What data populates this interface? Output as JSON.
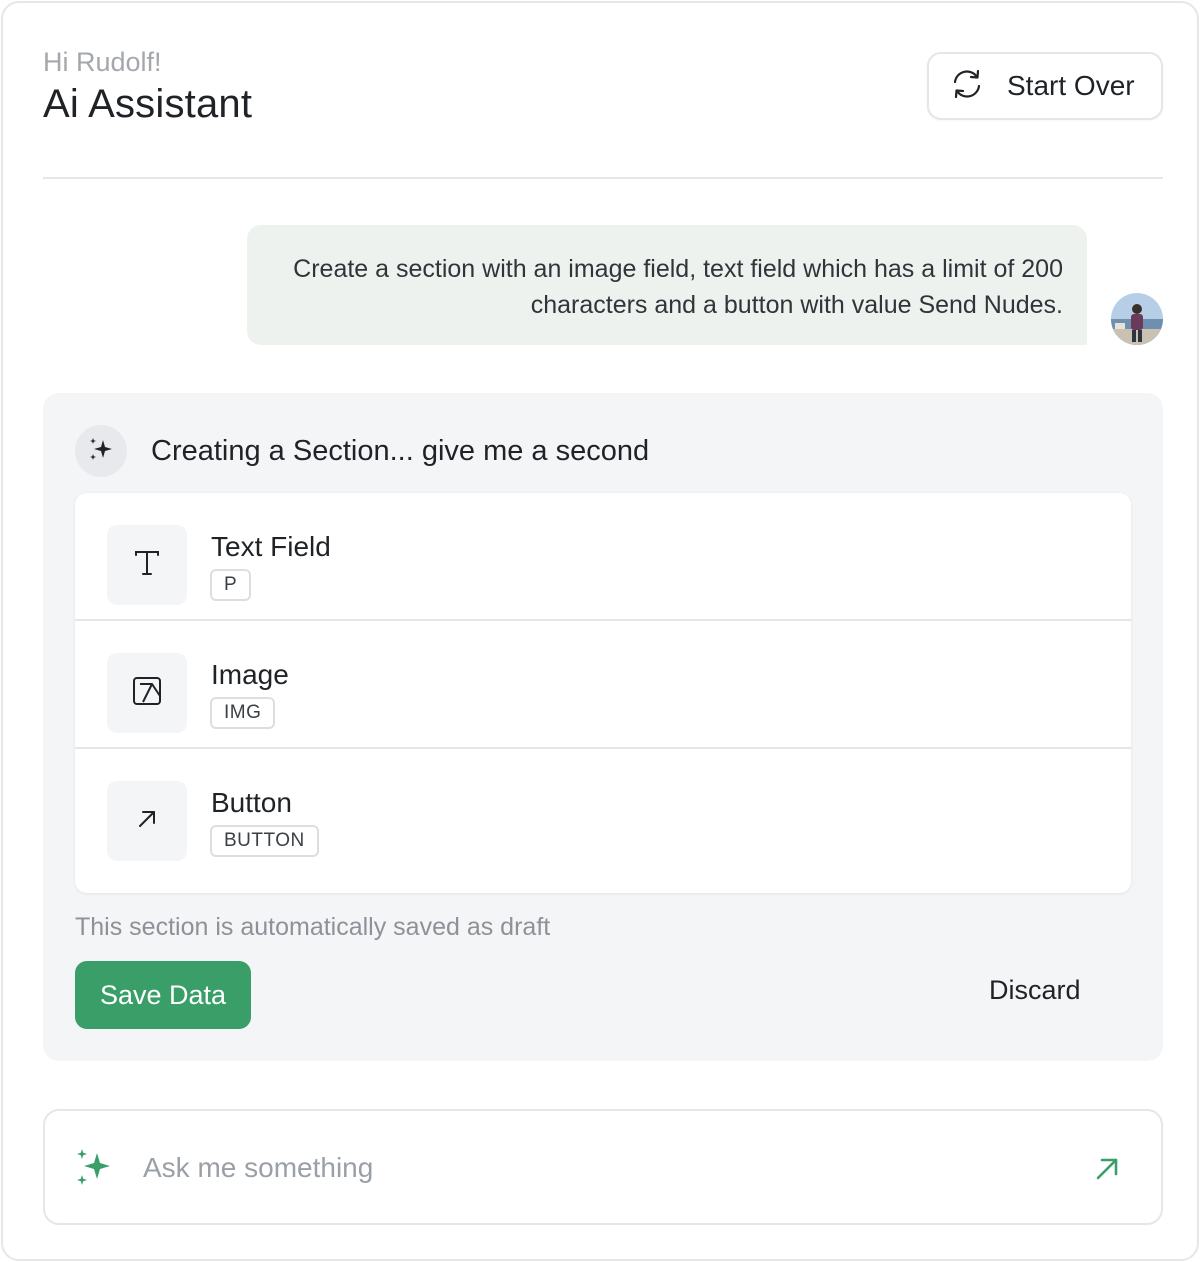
{
  "header": {
    "greeting": "Hi Rudolf!",
    "title": "Ai Assistant",
    "start_over_label": "Start Over"
  },
  "conversation": {
    "user_message": "Create a section with an image field, text field which has a limit of 200 characters and a button with value Send Nudes."
  },
  "ai_response": {
    "status": "Creating a Section... give me a second",
    "items": [
      {
        "name": "Text Field",
        "tag": "P",
        "icon": "text-t-icon"
      },
      {
        "name": "Image",
        "tag": "IMG",
        "icon": "image-icon"
      },
      {
        "name": "Button",
        "tag": "BUTTON",
        "icon": "arrow-up-right-icon"
      }
    ],
    "draft_note": "This section is automatically saved as draft",
    "save_label": "Save Data",
    "discard_label": "Discard"
  },
  "input": {
    "placeholder": "Ask me something",
    "value": ""
  },
  "colors": {
    "accent": "#3a9e68",
    "user_bubble": "#edf2ef",
    "card_bg": "#f4f5f7"
  }
}
